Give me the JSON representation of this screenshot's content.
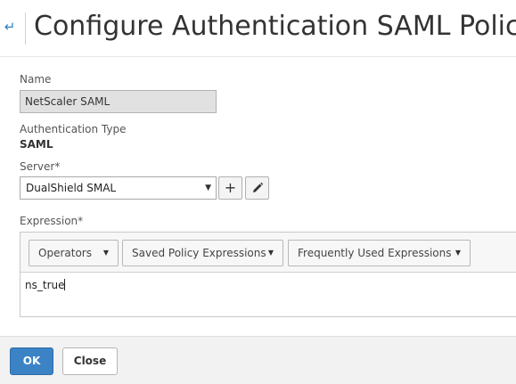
{
  "header": {
    "back_icon": "back-arrow-icon",
    "title": "Configure Authentication SAML Policy"
  },
  "form": {
    "name_label": "Name",
    "name_value": "NetScaler SAML",
    "auth_type_label": "Authentication Type",
    "auth_type_value": "SAML",
    "server_label": "Server*",
    "server_value": "DualShield SMAL",
    "add_icon": "plus-icon",
    "edit_icon": "pencil-icon",
    "expression_label": "Expression*",
    "expression_toolbar": {
      "operators": "Operators",
      "saved_policy_expressions": "Saved Policy Expressions",
      "frequently_used_expressions": "Frequently Used Expressions"
    },
    "expression_value": "ns_true"
  },
  "footer": {
    "ok_label": "OK",
    "close_label": "Close"
  },
  "colors": {
    "accent": "#3c83c6",
    "back_arrow": "#2d7fc5",
    "input_disabled_bg": "#e1e1e1",
    "footer_bg": "#f2f2f2"
  }
}
